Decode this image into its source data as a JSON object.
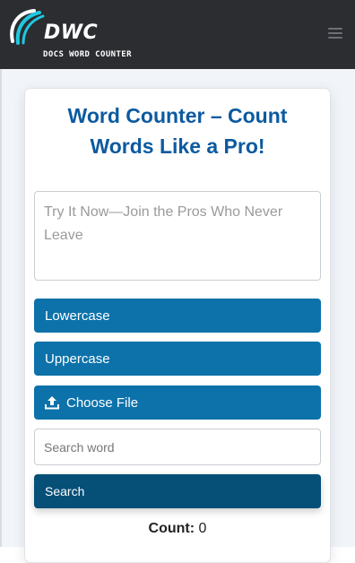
{
  "header": {
    "logo_text": "DWC",
    "logo_subtitle": "DOCS WORD COUNTER",
    "menu_icon": "hamburger-icon"
  },
  "main": {
    "title": "Word Counter – Count Words Like a Pro!",
    "textarea_placeholder": "Try It Now—Join the Pros Who Never Leave",
    "lowercase_label": "Lowercase",
    "uppercase_label": "Uppercase",
    "choose_file_label": "Choose File",
    "search_placeholder": "Search word",
    "search_label": "Search",
    "count_label": "Count:",
    "count_value": "0"
  },
  "colors": {
    "header_bg": "#2b2d31",
    "accent": "#0d72aa",
    "accent_dark": "#064f77",
    "title": "#0c5aa0",
    "logo_swoosh": "#1ec8e0"
  }
}
